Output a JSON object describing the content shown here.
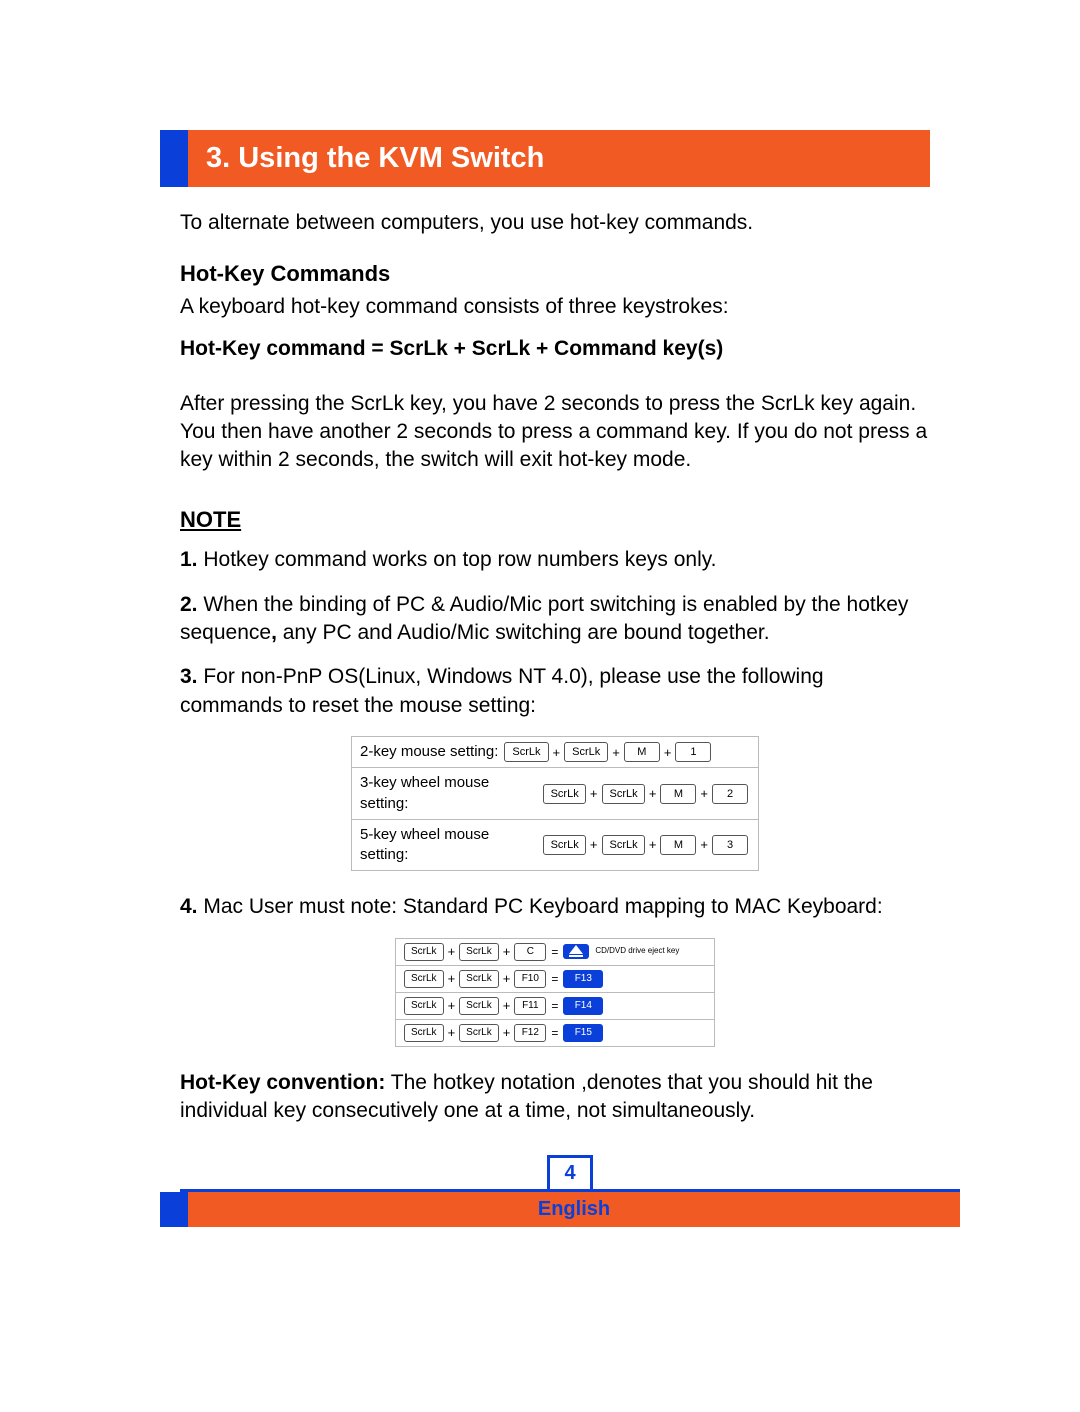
{
  "header": {
    "title": "3. Using the KVM Switch"
  },
  "intro": "To alternate between computers, you use hot-key commands.",
  "hotkey": {
    "heading": "Hot-Key Commands",
    "desc": "A keyboard hot-key command consists of three keystrokes:",
    "formula": "Hot-Key command = ScrLk + ScrLk + Command key(s)",
    "timing": "After pressing the ScrLk key, you have 2 seconds to press the ScrLk key again. You then have another 2 seconds to press a command key. If you do not press a key within 2 seconds, the switch will exit hot-key mode."
  },
  "note": {
    "heading": "NOTE",
    "items": {
      "n1": {
        "num": "1.",
        "text": "Hotkey command works on top row numbers keys only."
      },
      "n2": {
        "num": "2.",
        "pre": "When the binding of PC & Audio/Mic port switching is enabled by the hotkey sequence",
        "comma": ",",
        "post": " any PC and Audio/Mic switching are bound together."
      },
      "n3": {
        "num": "3.",
        "text": "For non-PnP OS(Linux, Windows NT 4.0), please use the following commands to reset the mouse setting:"
      },
      "n4": {
        "num": "4.",
        "text": "Mac User must note: Standard PC Keyboard mapping to MAC Keyboard:"
      }
    }
  },
  "mouse_table": {
    "rows": [
      {
        "label": "2-key mouse setting:",
        "keys": [
          "ScrLk",
          "ScrLk",
          "M",
          "1"
        ]
      },
      {
        "label": "3-key wheel mouse setting:",
        "keys": [
          "ScrLk",
          "ScrLk",
          "M",
          "2"
        ]
      },
      {
        "label": "5-key wheel mouse setting:",
        "keys": [
          "ScrLk",
          "ScrLk",
          "M",
          "3"
        ]
      }
    ]
  },
  "mac_table": {
    "rows": [
      {
        "in": [
          "ScrLk",
          "ScrLk",
          "C"
        ],
        "out_type": "eject",
        "out_label": "CD/DVD drive eject key"
      },
      {
        "in": [
          "ScrLk",
          "ScrLk",
          "F10"
        ],
        "out_type": "key",
        "out": "F13"
      },
      {
        "in": [
          "ScrLk",
          "ScrLk",
          "F11"
        ],
        "out_type": "key",
        "out": "F14"
      },
      {
        "in": [
          "ScrLk",
          "ScrLk",
          "F12"
        ],
        "out_type": "key",
        "out": "F15"
      }
    ]
  },
  "convention": {
    "lead": "Hot-Key convention:",
    "text": " The hotkey notation ,denotes that you should hit the individual key consecutively one at a time, not simultaneously."
  },
  "footer": {
    "page": "4",
    "lang": "English"
  }
}
